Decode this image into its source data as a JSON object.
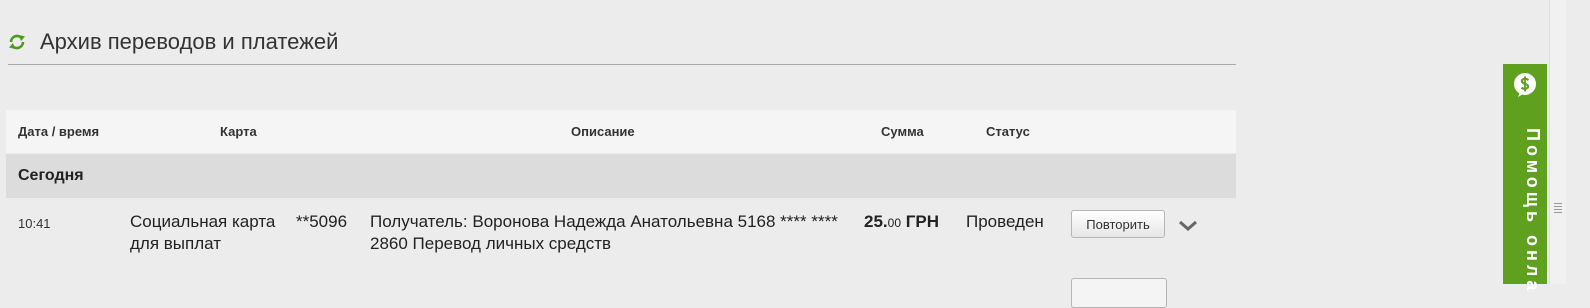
{
  "header": {
    "title": "Архив переводов и платежей",
    "icon": "refresh-icon"
  },
  "table": {
    "columns": [
      "Дата / время",
      "Карта",
      "Описание",
      "Сумма",
      "Статус"
    ],
    "groups": [
      {
        "label": "Сегодня",
        "rows": [
          {
            "time": "10:41",
            "card_name": "Социальная карта для выплат",
            "card_number": "**5096",
            "description": "Получатель: Воронова Надежда Анатольевна 5168 **** **** 2860 Перевод личных средств",
            "amount_int": "25.",
            "amount_cents": "00",
            "currency": "ГРН",
            "status": "Проведен",
            "repeat_label": "Повторить"
          }
        ]
      }
    ]
  },
  "help": {
    "label": "Помощь онла",
    "icon": "chat-dollar-icon",
    "color": "#5fa01f"
  }
}
